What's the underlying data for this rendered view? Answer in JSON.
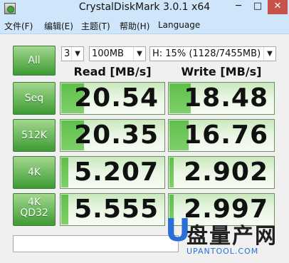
{
  "window": {
    "title": "CrystalDiskMark 3.0.1 x64",
    "minimize": "─",
    "maximize": "□",
    "close": "✕"
  },
  "menu": [
    "文件(F)",
    "编辑(E)",
    "主题(T)",
    "帮助(H)",
    "Language"
  ],
  "controls": {
    "all_label": "All",
    "count": "3",
    "size": "100MB",
    "drive": "H: 15% (1128/7455MB)"
  },
  "headers": {
    "read": "Read [MB/s]",
    "write": "Write [MB/s]"
  },
  "rows": [
    {
      "label": "Seq",
      "read": "20.54",
      "write": "18.48"
    },
    {
      "label": "512K",
      "read": "20.35",
      "write": "16.76"
    },
    {
      "label": "4K",
      "read": "5.207",
      "write": "2.902"
    },
    {
      "label_line1": "4K",
      "label_line2": "QD32",
      "read": "5.555",
      "write": "2.997"
    }
  ],
  "levels": {
    "read": [
      0.22,
      0.22,
      0.07,
      0.07
    ],
    "write": [
      0.2,
      0.18,
      0.04,
      0.04
    ]
  },
  "watermark": {
    "letter": "U",
    "name": "盘量产网",
    "url": "UPANTOOL.COM"
  },
  "colors": {
    "titlebar": "#cfe6fa",
    "button_green": "#3d9b33",
    "watermark_blue": "#2a6fd6"
  }
}
